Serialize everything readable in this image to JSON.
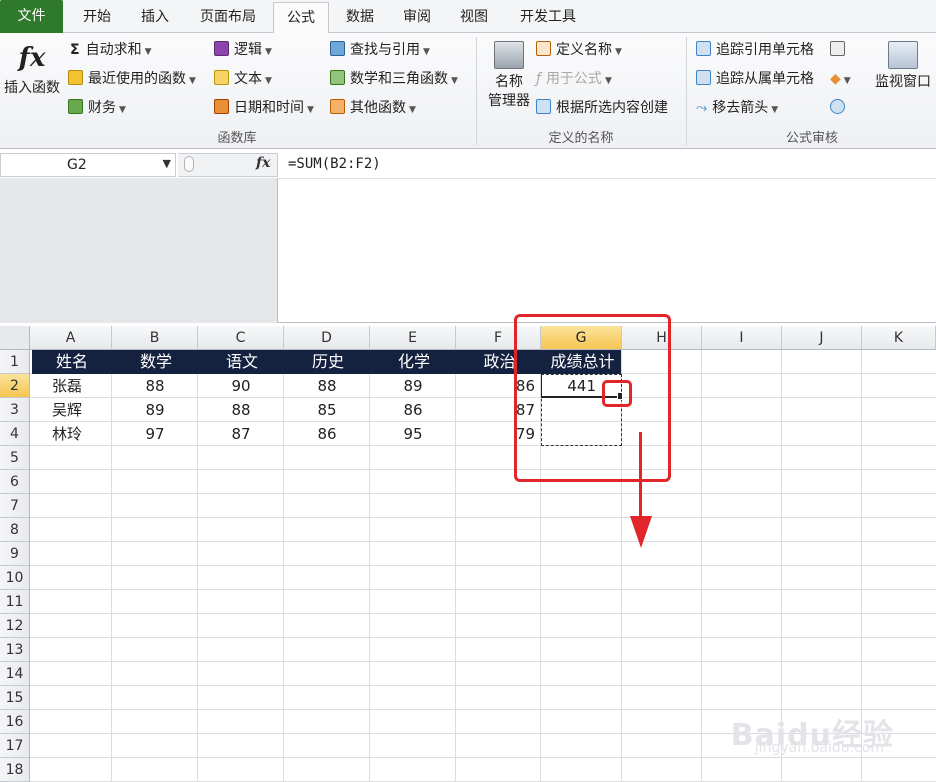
{
  "tabs": [
    "文件",
    "开始",
    "插入",
    "页面布局",
    "公式",
    "数据",
    "审阅",
    "视图",
    "开发工具"
  ],
  "active_tab": "公式",
  "ribbon": {
    "insert_function": "插入函数",
    "function_library": {
      "label": "函数库",
      "autosum": "自动求和",
      "recent": "最近使用的函数",
      "finance": "财务",
      "logic": "逻辑",
      "text": "文本",
      "datetime": "日期和时间",
      "lookup": "查找与引用",
      "math": "数学和三角函数",
      "other": "其他函数"
    },
    "defined_names": {
      "label": "定义的名称",
      "name_manager_1": "名称",
      "name_manager_2": "管理器",
      "define_name": "定义名称",
      "use_in_formula": "用于公式",
      "create_from_selection": "根据所选内容创建"
    },
    "formula_auditing": {
      "label": "公式审核",
      "trace_precedents": "追踪引用单元格",
      "trace_dependents": "追踪从属单元格",
      "remove_arrows": "移去箭头",
      "watch_window": "监视窗口"
    }
  },
  "formula_bar": {
    "name_box": "G2",
    "fx": "fx",
    "formula": "=SUM(B2:F2)"
  },
  "columns": [
    "A",
    "B",
    "C",
    "D",
    "E",
    "F",
    "G",
    "H",
    "I",
    "J",
    "K"
  ],
  "rows": [
    "1",
    "2",
    "3",
    "4",
    "5",
    "6",
    "7",
    "8",
    "9",
    "10",
    "11",
    "12",
    "13",
    "14",
    "15",
    "16",
    "17",
    "18"
  ],
  "header_row": [
    "姓名",
    "数学",
    "语文",
    "历史",
    "化学",
    "政治",
    "成绩总计"
  ],
  "data_rows": [
    {
      "name": "张磊",
      "values": [
        "88",
        "90",
        "88",
        "89",
        "86"
      ],
      "total": "441"
    },
    {
      "name": "吴辉",
      "values": [
        "89",
        "88",
        "85",
        "86",
        "87"
      ],
      "total": ""
    },
    {
      "name": "林玲",
      "values": [
        "97",
        "87",
        "86",
        "95",
        "79"
      ],
      "total": ""
    }
  ],
  "watermark": {
    "brand": "Baidu经验",
    "url": "jingyan.baidu.com"
  },
  "colors": {
    "file_tab": "#2f7a2a",
    "header_fill": "#14223f",
    "annotation": "#e0262b",
    "selection": "#f5c552"
  }
}
